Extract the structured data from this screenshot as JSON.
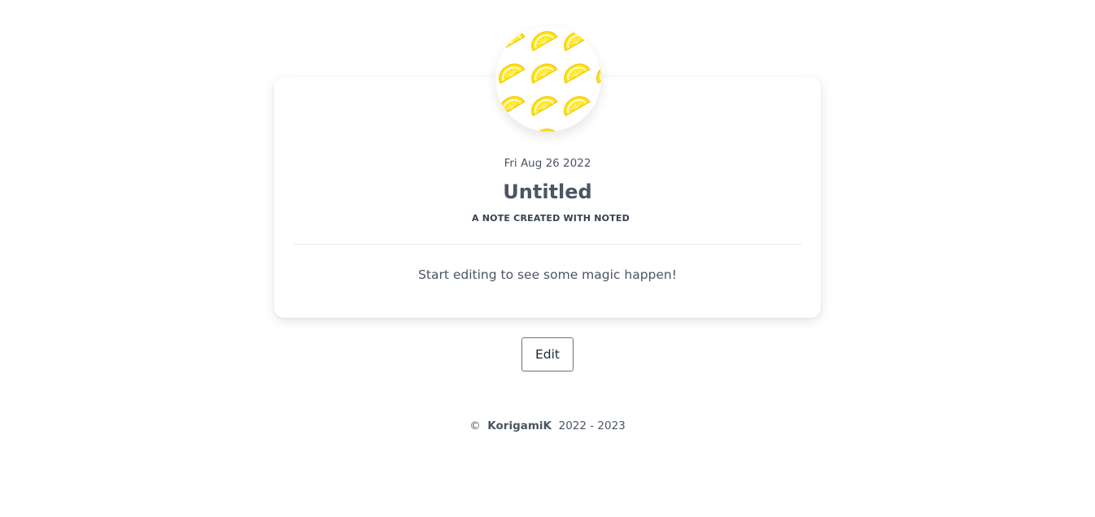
{
  "note": {
    "cover_icon": "lemon-pattern",
    "date": "Fri Aug 26 2022",
    "title": "Untitled",
    "subtitle": "A NOTE CREATED WITH NOTED",
    "content": "Start editing to see some magic happen!"
  },
  "actions": {
    "edit_label": "Edit"
  },
  "footer": {
    "copyright_symbol": "©",
    "author": "KorigamiK",
    "years": "2022 - 2023"
  },
  "colors": {
    "lemon_fill": "#fde619",
    "lemon_stroke": "#f5c400",
    "text": "#4b5563",
    "divider": "#e5e7eb"
  }
}
